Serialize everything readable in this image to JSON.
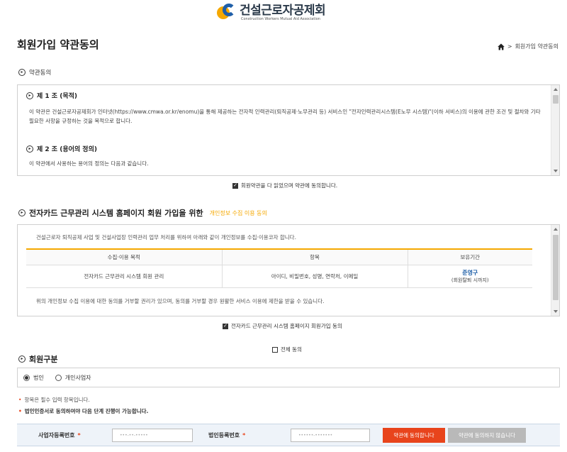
{
  "brand": {
    "name_ko": "건설근로자공제회",
    "name_en": "Construction Workers Mutual Aid Association",
    "colors": {
      "orange": "#f5a800",
      "blue": "#1f5fa8",
      "red": "#e8441c"
    }
  },
  "header": {
    "title": "회원가입 약관동의",
    "breadcrumb": {
      "icon": "home-icon",
      "current": "회원가입 약관동의"
    }
  },
  "terms": {
    "section_label": "약관동의",
    "articles": [
      {
        "title": "제 1 조 (목적)",
        "body": "이 약관은 건설근로자공제회가 인터넷(https://www.cmwa.or.kr/enomu)을 통해 제공하는 전자적 인력관리(퇴직공제·노무관리 등) 서비스인 \"전자인력관리시스템(E노무 시스템)\"(이하 서비스)의 이용에 관한 조건 및 절차와 기타 필요한 사항을 규정하는 것을 목적으로 합니다."
      },
      {
        "title": "제 2 조 (용어의 정의)",
        "body": "이 약관에서 사용하는 용어의 정의는 다음과 같습니다."
      }
    ],
    "agree_label": "회원약관을 다 읽었으며 약관에 동의합니다."
  },
  "privacy": {
    "section_title": "전자카드 근무관리 시스템 홈페이지 회원 가입을 위한",
    "section_sub": "개인정보 수집 이용 동의",
    "intro": "건설근로자 퇴직공제 사업 및 건설사업장 인력관리 업무 처리를 위하여 아래와 같이 개인정보를 수집·이용코자 합니다.",
    "table": {
      "headers": [
        "수집·이용 목적",
        "항목",
        "보유기간"
      ],
      "rows": [
        {
          "purpose": "전자카드 근무관리 시스템 회원 관리",
          "items": "아이디, 비밀번호, 성명, 연락처, 이메일",
          "retention": "준영구",
          "retention_note": "(회원탈퇴 시까지)"
        }
      ]
    },
    "notice": "위의 개인정보 수집 이용에 대한 동의를 거부할 권리가 있으며, 동의를 거부할 경우 원활한 서비스 이용에 제한을 받을 수 있습니다.",
    "agree_label": "전자카드 근무관리 시스템 홈페이지 회원가입 동의"
  },
  "all_agree_label": "전체 동의",
  "member_type": {
    "title": "회원구분",
    "options": [
      {
        "label": "법인",
        "selected": true
      },
      {
        "label": "개인사업자",
        "selected": false
      }
    ]
  },
  "notes": {
    "required": "항목은 필수 입력 항목입니다.",
    "cert": "법인인증서로 동의하여야 다음 단계 진행이 가능합니다."
  },
  "form": {
    "biz_label": "사업자등록번호",
    "biz_value": "•••-••-•••••",
    "corp_label": "법인등록번호",
    "corp_value": "••••••-•••••••",
    "agree_button": "약관에 동의합니다",
    "disagree_button": "약관에 동의하지 않습니다"
  }
}
